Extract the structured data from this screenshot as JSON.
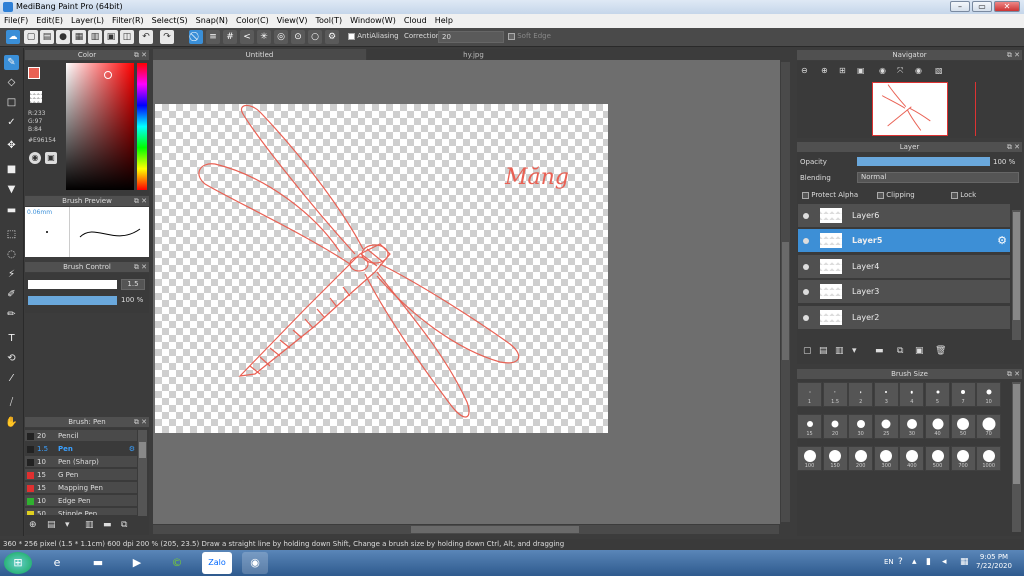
{
  "app": {
    "title": "MediBang Paint Pro (64bit)"
  },
  "menu": [
    "File(F)",
    "Edit(E)",
    "Layer(L)",
    "Filter(R)",
    "Select(S)",
    "Snap(N)",
    "Color(C)",
    "View(V)",
    "Tool(T)",
    "Window(W)",
    "Cloud",
    "Help"
  ],
  "toolbar": {
    "antialiasing": "AntiAliasing",
    "correction_label": "Correction",
    "correction_value": "20",
    "soft_edge": "Soft Edge"
  },
  "tabs": {
    "active": "Untitled",
    "other": "hy.jpg"
  },
  "color_panel": {
    "title": "Color",
    "r": "R:233",
    "g": "G:97",
    "b": "B:84",
    "hex": "#E96154",
    "main_color": "#e96154"
  },
  "brush_preview": {
    "title": "Brush Preview",
    "size": "0.06mm"
  },
  "brush_control": {
    "title": "Brush Control",
    "size": "1.5",
    "opacity": "100 %"
  },
  "brush_list": {
    "title": "Brush: Pen",
    "items": [
      {
        "size": "20",
        "name": "Pencil",
        "color": "#222222"
      },
      {
        "size": "1.5",
        "name": "Pen",
        "color": "#222222"
      },
      {
        "size": "10",
        "name": "Pen (Sharp)",
        "color": "#222222"
      },
      {
        "size": "15",
        "name": "G Pen",
        "color": "#e03030"
      },
      {
        "size": "15",
        "name": "Mapping Pen",
        "color": "#e03030"
      },
      {
        "size": "10",
        "name": "Edge Pen",
        "color": "#30b030"
      },
      {
        "size": "50",
        "name": "Stipple Pen",
        "color": "#e0d020"
      }
    ]
  },
  "canvas": {
    "text": "Măng",
    "stroke_color": "#e96154"
  },
  "navigator": {
    "title": "Navigator"
  },
  "layer_panel": {
    "title": "Layer",
    "opacity_label": "Opacity",
    "opacity_value": "100 %",
    "blending_label": "Blending",
    "blending_value": "Normal",
    "protect_alpha": "Protect Alpha",
    "clipping": "Clipping",
    "lock": "Lock",
    "layers": [
      "Layer6",
      "Layer5",
      "Layer4",
      "Layer3",
      "Layer2"
    ],
    "selected": "Layer5"
  },
  "brush_size": {
    "title": "Brush Size",
    "sizes": [
      "1",
      "1.5",
      "2",
      "3",
      "4",
      "5",
      "7",
      "10",
      "15",
      "20",
      "30",
      "25",
      "30",
      "40",
      "50",
      "70",
      "100",
      "150",
      "200",
      "300",
      "400",
      "500",
      "700",
      "1000"
    ]
  },
  "status": {
    "text": "360 * 256 pixel  (1.5 * 1.1cm)  600 dpi  200 %  (205, 23.5)   Draw a straight line by holding down Shift, Change a brush size by holding down Ctrl, Alt, and dragging"
  },
  "taskbar": {
    "lang": "EN",
    "time": "9:05 PM",
    "date": "7/22/2020",
    "apps": [
      "Zalo"
    ]
  }
}
